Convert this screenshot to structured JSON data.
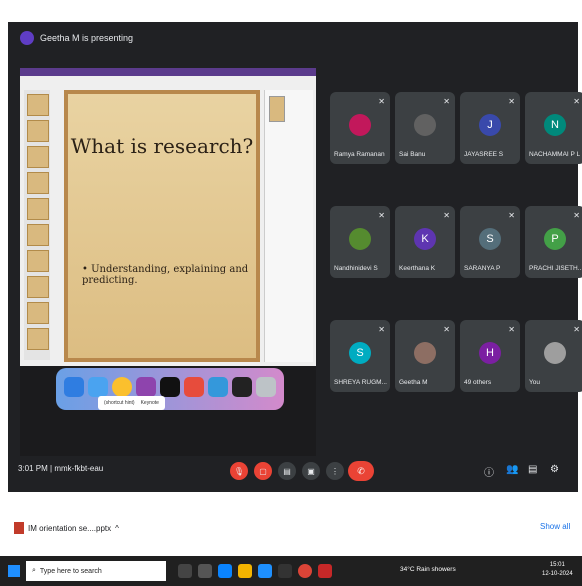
{
  "meet": {
    "presenting_text": "Geetha M is presenting",
    "slide": {
      "title": "What is research?",
      "bullet": "• Understanding, explaining and predicting."
    },
    "dock_tooltip": {
      "left": "(shortcut hint)",
      "right": "Keynote"
    },
    "participants": [
      {
        "name": "Ramya Ramanan",
        "initial": "",
        "color": "#c2185b"
      },
      {
        "name": "Sai Banu",
        "initial": "",
        "color": "#616161"
      },
      {
        "name": "JAYASREE S",
        "initial": "J",
        "color": "#3949ab"
      },
      {
        "name": "NACHAMMAI P L",
        "initial": "N",
        "color": "#00897b"
      },
      {
        "name": "Nandhinidevi S",
        "initial": "",
        "color": "#558b2f"
      },
      {
        "name": "Keerthana K",
        "initial": "K",
        "color": "#5e35b1"
      },
      {
        "name": "SARANYA P",
        "initial": "S",
        "color": "#546e7a"
      },
      {
        "name": "PRACHI JISETH...",
        "initial": "P",
        "color": "#43a047"
      },
      {
        "name": "SHREYA RUGM...",
        "initial": "S",
        "color": "#00acc1"
      },
      {
        "name": "Geetha M",
        "initial": "",
        "color": "#8d6e63"
      },
      {
        "name": "49 others",
        "initial": "H",
        "color": "#7b1fa2"
      },
      {
        "name": "You",
        "initial": "",
        "color": "#9e9e9e"
      }
    ],
    "time": "3:01 PM",
    "separator": "|",
    "meeting_code": "mmk-fkbt-eau",
    "controls": [
      "mic",
      "cam",
      "cc",
      "present",
      "more"
    ],
    "end_call_label": "✆",
    "right_controls": [
      "ⓘ",
      "👥",
      "▤",
      "⚙"
    ]
  },
  "downloads": {
    "file_name": "IM orientation se....pptx",
    "show_all": "Show all"
  },
  "taskbar": {
    "search_placeholder": "Type here to search",
    "weather": "34°C Rain showers",
    "time": "15:01",
    "date": "12-10-2024"
  }
}
